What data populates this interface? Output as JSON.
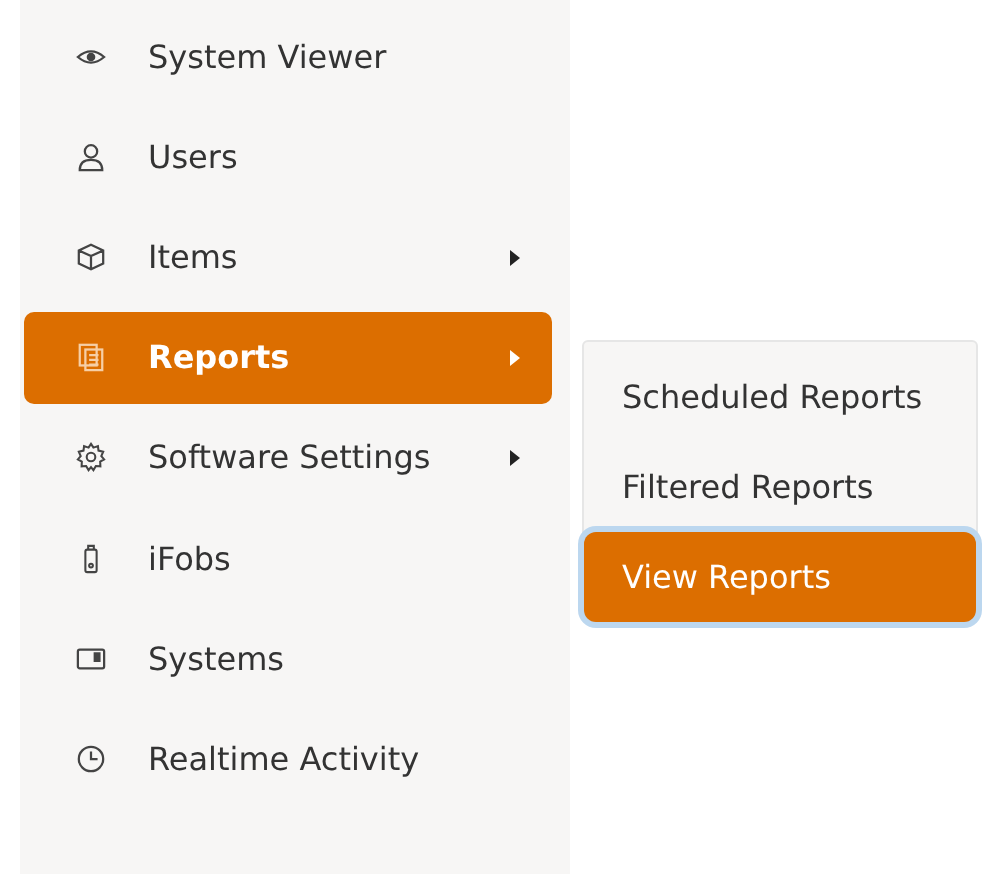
{
  "sidebar": {
    "items": [
      {
        "label": "System Viewer",
        "selected": false,
        "has_submenu": false
      },
      {
        "label": "Users",
        "selected": false,
        "has_submenu": false
      },
      {
        "label": "Items",
        "selected": false,
        "has_submenu": true
      },
      {
        "label": "Reports",
        "selected": true,
        "has_submenu": true
      },
      {
        "label": "Software Settings",
        "selected": false,
        "has_submenu": true
      },
      {
        "label": "iFobs",
        "selected": false,
        "has_submenu": false
      },
      {
        "label": "Systems",
        "selected": false,
        "has_submenu": false
      },
      {
        "label": "Realtime Activity",
        "selected": false,
        "has_submenu": false
      }
    ]
  },
  "submenu": {
    "items": [
      {
        "label": "Scheduled Reports",
        "selected": false
      },
      {
        "label": "Filtered Reports",
        "selected": false
      },
      {
        "label": "View Reports",
        "selected": true
      }
    ]
  }
}
